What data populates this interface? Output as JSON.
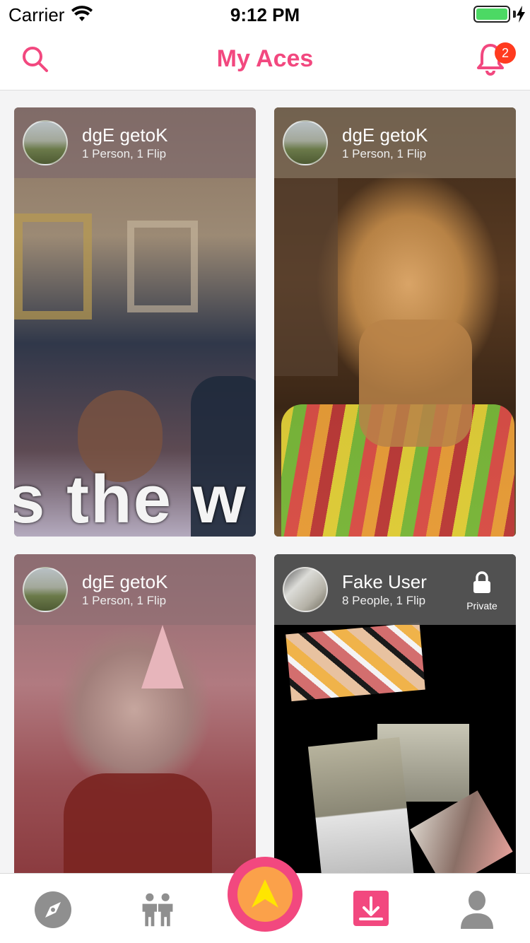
{
  "status_bar": {
    "carrier": "Carrier",
    "time": "9:12 PM"
  },
  "header": {
    "title": "My Aces",
    "notification_count": "2"
  },
  "cards": [
    {
      "name": "dgE getoK",
      "meta": "1 Person, 1 Flip",
      "overlay_text": "s the w"
    },
    {
      "name": "dgE getoK",
      "meta": "1 Person, 1 Flip"
    },
    {
      "name": "dgE getoK",
      "meta": "1 Person, 1 Flip"
    },
    {
      "name": "Fake User",
      "meta": "8 People, 1 Flip",
      "privacy_label": "Private"
    }
  ],
  "tab_bar": {
    "items": [
      "compass-icon",
      "people-icon",
      "ace-icon",
      "download-icon",
      "profile-icon"
    ]
  },
  "colors": {
    "accent": "#f2487f",
    "orange": "#fba14a",
    "yellow": "#ffe600",
    "badge": "#ff3b1f"
  }
}
